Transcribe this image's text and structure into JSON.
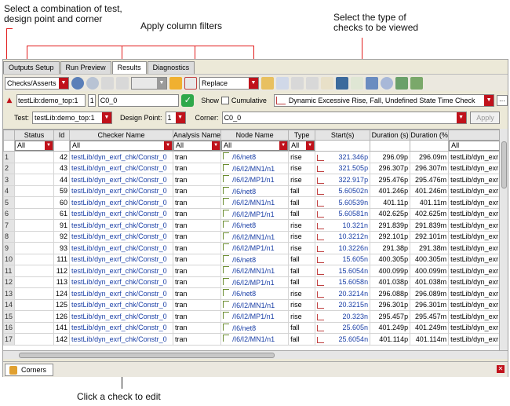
{
  "annotations": {
    "select_combo": "Select a combination of test, design point and corner",
    "column_filters": "Apply column filters",
    "check_type": "Select the type of checks to be viewed",
    "click_check": "Click a check  to edit"
  },
  "tabs": [
    "Outputs Setup",
    "Run Preview",
    "Results",
    "Diagnostics"
  ],
  "toolbar": {
    "view": "Checks/Asserts",
    "mode": "Replace"
  },
  "row2": {
    "test_combo": "testLib:demo_top:1",
    "dp_value": "1",
    "corner_value": "C0_0",
    "show_label": "Show",
    "cumulative_label": "Cumulative",
    "check_type": "Dynamic Excessive Rise, Fall, Undefined State Time Check"
  },
  "row3": {
    "test_label": "Test:",
    "test_value": "testLib:demo_top:1",
    "dp_label": "Design Point:",
    "dp_value": "1",
    "corner_label": "Corner:",
    "corner_value": "C0_0",
    "apply_label": "Apply"
  },
  "columns": [
    "Status",
    "Id",
    "Checker Name",
    "Analysis Name",
    "Node Name",
    "Type",
    "Start(s)",
    "Duration (s)",
    "Duration (%",
    ""
  ],
  "filters": [
    "All",
    "",
    "All",
    "All",
    "All",
    "All",
    "",
    "",
    "",
    "All"
  ],
  "rows": [
    [
      "1",
      "",
      "42",
      "testLib/dyn_exrf_chk/Constr_0",
      "tran",
      "/I6/net8",
      "rise",
      "321.346p",
      "296.09p",
      "296.09m",
      "testLib/dyn_exr"
    ],
    [
      "2",
      "",
      "43",
      "testLib/dyn_exrf_chk/Constr_0",
      "tran",
      "/I6/I2/MN1/n1",
      "rise",
      "321.505p",
      "296.307p",
      "296.307m",
      "testLib/dyn_exr"
    ],
    [
      "3",
      "",
      "44",
      "testLib/dyn_exrf_chk/Constr_0",
      "tran",
      "/I6/I2/MP1/n1",
      "rise",
      "322.917p",
      "295.476p",
      "295.476m",
      "testLib/dyn_exr"
    ],
    [
      "4",
      "",
      "59",
      "testLib/dyn_exrf_chk/Constr_0",
      "tran",
      "/I6/net8",
      "fall",
      "5.60502n",
      "401.246p",
      "401.246m",
      "testLib/dyn_exr"
    ],
    [
      "5",
      "",
      "60",
      "testLib/dyn_exrf_chk/Constr_0",
      "tran",
      "/I6/I2/MN1/n1",
      "fall",
      "5.60539n",
      "401.11p",
      "401.11m",
      "testLib/dyn_exr"
    ],
    [
      "6",
      "",
      "61",
      "testLib/dyn_exrf_chk/Constr_0",
      "tran",
      "/I6/I2/MP1/n1",
      "fall",
      "5.60581n",
      "402.625p",
      "402.625m",
      "testLib/dyn_exr"
    ],
    [
      "7",
      "",
      "91",
      "testLib/dyn_exrf_chk/Constr_0",
      "tran",
      "/I6/net8",
      "rise",
      "10.321n",
      "291.839p",
      "291.839m",
      "testLib/dyn_exr"
    ],
    [
      "8",
      "",
      "92",
      "testLib/dyn_exrf_chk/Constr_0",
      "tran",
      "/I6/I2/MN1/n1",
      "rise",
      "10.3212n",
      "292.101p",
      "292.101m",
      "testLib/dyn_exr"
    ],
    [
      "9",
      "",
      "93",
      "testLib/dyn_exrf_chk/Constr_0",
      "tran",
      "/I6/I2/MP1/n1",
      "rise",
      "10.3226n",
      "291.38p",
      "291.38m",
      "testLib/dyn_exr"
    ],
    [
      "10",
      "",
      "111",
      "testLib/dyn_exrf_chk/Constr_0",
      "tran",
      "/I6/net8",
      "fall",
      "15.605n",
      "400.305p",
      "400.305m",
      "testLib/dyn_exr"
    ],
    [
      "11",
      "",
      "112",
      "testLib/dyn_exrf_chk/Constr_0",
      "tran",
      "/I6/I2/MN1/n1",
      "fall",
      "15.6054n",
      "400.099p",
      "400.099m",
      "testLib/dyn_exr"
    ],
    [
      "12",
      "",
      "113",
      "testLib/dyn_exrf_chk/Constr_0",
      "tran",
      "/I6/I2/MP1/n1",
      "fall",
      "15.6058n",
      "401.038p",
      "401.038m",
      "testLib/dyn_exr"
    ],
    [
      "13",
      "",
      "124",
      "testLib/dyn_exrf_chk/Constr_0",
      "tran",
      "/I6/net8",
      "rise",
      "20.3214n",
      "296.088p",
      "296.089m",
      "testLib/dyn_exr"
    ],
    [
      "14",
      "",
      "125",
      "testLib/dyn_exrf_chk/Constr_0",
      "tran",
      "/I6/I2/MN1/n1",
      "rise",
      "20.3215n",
      "296.301p",
      "296.301m",
      "testLib/dyn_exr"
    ],
    [
      "15",
      "",
      "126",
      "testLib/dyn_exrf_chk/Constr_0",
      "tran",
      "/I6/I2/MP1/n1",
      "rise",
      "20.323n",
      "295.457p",
      "295.457m",
      "testLib/dyn_exr"
    ],
    [
      "16",
      "",
      "141",
      "testLib/dyn_exrf_chk/Constr_0",
      "tran",
      "/I6/net8",
      "fall",
      "25.605n",
      "401.249p",
      "401.249m",
      "testLib/dyn_exr"
    ],
    [
      "17",
      "",
      "142",
      "testLib/dyn_exrf_chk/Constr_0",
      "tran",
      "/I6/I2/MN1/n1",
      "fall",
      "25.6054n",
      "401.114p",
      "401.114m",
      "testLib/dyn_exr"
    ]
  ],
  "bottom": {
    "corners_tab": "Corners"
  },
  "colors": {
    "accent_red": "#c0121b",
    "link_blue": "#1a3fa6",
    "annotation_line": "#e21c1c"
  }
}
